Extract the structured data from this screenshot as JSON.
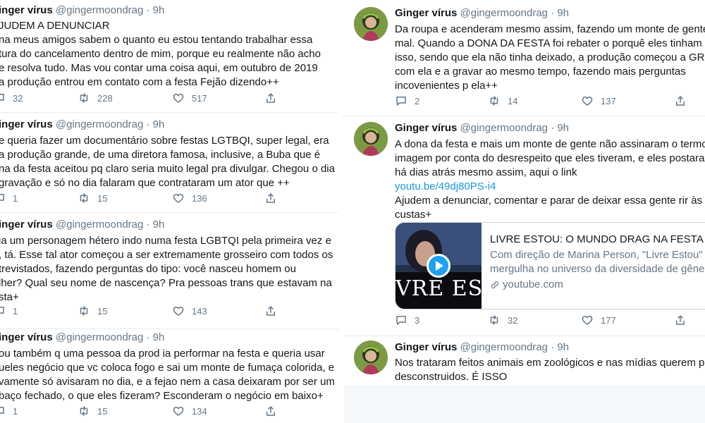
{
  "author": {
    "name": "Ginger vírus",
    "handle": "@gingermoondrag",
    "time": "9h"
  },
  "left_tweets": [
    {
      "name": "inger vírus",
      "header_rest": "@gingermoondrag · 9h",
      "body": "JUDEM A DENUNCIAR\nna meus amigos sabem o quanto eu estou tentando trabalhar essa\ntura do cancelamento dentro de mim, porque eu realmente não acho\ne resolva tudo. Mas vou contar uma coisa aqui, em outubro de 2019\na produção entrou em contato com a festa Fejão dizendo++",
      "replies": "32",
      "retweets": "228",
      "likes": "517"
    },
    {
      "name": "inger vírus",
      "header_rest": "@gingermoondrag · 9h",
      "body": "e queria fazer um documentário sobre festas LGTBQI, super legal, era\na produção grande, de uma diretora famosa, inclusive, a Buba que é\nna da festa aceitou pq claro seria muito legal pra divulgar. Chegou o dia\ngravação e só no dia falaram que contrataram um ator que ++",
      "replies": "1",
      "retweets": "15",
      "likes": "136"
    },
    {
      "name": "inger vírus",
      "header_rest": "@gingermoondrag · 9h",
      "body": "ia um personagem hétero indo numa festa LGBTQI pela primeira vez e\n, tá. Esse tal ator começou a ser extremamente grosseiro com todos os\ntrevistados, fazendo perguntas do tipo: você nasceu homem ou\nlher? Qual seu nome de nascença? Pra pessoas trans que estavam na\nsta+",
      "replies": "1",
      "retweets": "15",
      "likes": "143"
    },
    {
      "name": "inger vírus",
      "header_rest": "@gingermoondrag · 9h",
      "body": "ou também q uma pessoa da prod ia performar na festa e queria usar\nueles negócio que vc coloca fogo e sai um monte de fumaça colorida, e\nvamente só avisaram no dia, e a fejao nem a casa deixaram por ser um\nbaço fechado, o que eles fizeram? Esconderam o negócio em baixo+",
      "replies": "1",
      "retweets": "15",
      "likes": "134"
    }
  ],
  "right_tweets": [
    {
      "body": "Da roupa e acenderam mesmo assim, fazendo um monte de gente\nmal. Quando a DONA DA FESTA foi rebater o porquê eles tinham fe\nisso, sendo que ela não tinha deixado, a produção começou a GRIT\ncom ela e a gravar ao mesmo tempo, fazendo mais perguntas\nincovenientes p ela++",
      "replies": "2",
      "retweets": "14",
      "likes": "137"
    },
    {
      "body_before": "A dona da festa e mais um monte de gente não assinaram o termo\nimagem por conta do desrespeito que eles tiveram, e eles postara\nhá dias atrás mesmo assim, aqui o link",
      "link": "youtu.be/49dj80PS-i4",
      "body_after": "Ajudem a denunciar, comentar e parar de deixar essa gente rir às n\ncustas+",
      "card": {
        "thumb_text": "VRE ESTO",
        "title": "LIVRE ESTOU: O MUNDO DRAG NA FESTA FEJ",
        "desc": "Com direção de Marina Person, \"Livre Estou\"\nmergulha no universo da diversidade de gêner",
        "domain": "youtube.com"
      },
      "replies": "3",
      "retweets": "32",
      "likes": "177"
    },
    {
      "body": "Nos trataram feitos animais em zoológicos e nas mídias querem pa\ndesconstruidos. É ISSO"
    }
  ],
  "colors": {
    "accent": "#1b95e0",
    "muted": "#657786",
    "text": "#14171a",
    "divider": "#e6ecf0"
  },
  "icons": [
    "reply-icon",
    "retweet-icon",
    "like-icon",
    "share-icon",
    "play-icon",
    "link-icon"
  ]
}
